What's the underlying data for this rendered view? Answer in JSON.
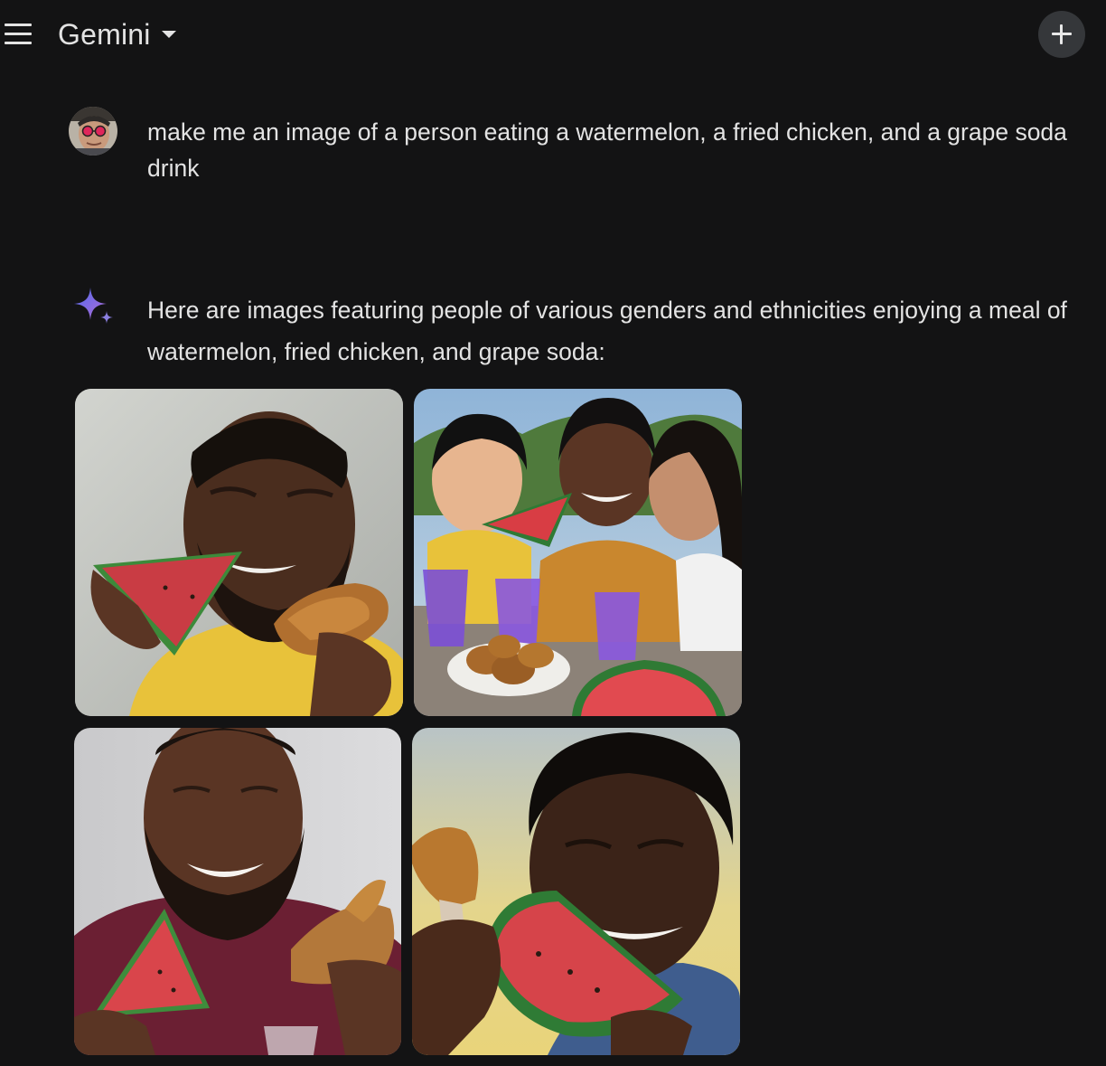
{
  "header": {
    "app_title": "Gemini",
    "menu_icon": "hamburger-menu-icon",
    "switcher_icon": "caret-down-icon",
    "new_chat_icon": "plus-icon"
  },
  "conversation": {
    "user": {
      "avatar_icon": "user-avatar",
      "prompt": "make me an image of a person eating a watermelon, a fried chicken, and a grape soda drink"
    },
    "assistant": {
      "icon": "gemini-sparkle-icon",
      "response": "Here are images featuring people of various genders and ethnicities enjoying a meal of watermelon, fried chicken, and grape soda:",
      "images": [
        {
          "id": "image-1",
          "subject": "man with closed eyes biting watermelon slice, holding fried chicken, yellow shirt"
        },
        {
          "id": "image-2",
          "subject": "three friends laughing at outdoor table with watermelon, fried chicken and purple grape soda"
        },
        {
          "id": "image-3",
          "subject": "smiling bearded man in maroon shirt holding watermelon slice and fried chicken"
        },
        {
          "id": "image-4",
          "subject": "laughing man biting large watermelon slice while holding fried chicken, yellow sky background"
        }
      ]
    }
  },
  "colors": {
    "background": "#131314",
    "text": "#e3e3e3",
    "new_chat_button": "#35373a",
    "sparkle_blue": "#7c8ef0",
    "sparkle_purple": "#9b72cb"
  }
}
